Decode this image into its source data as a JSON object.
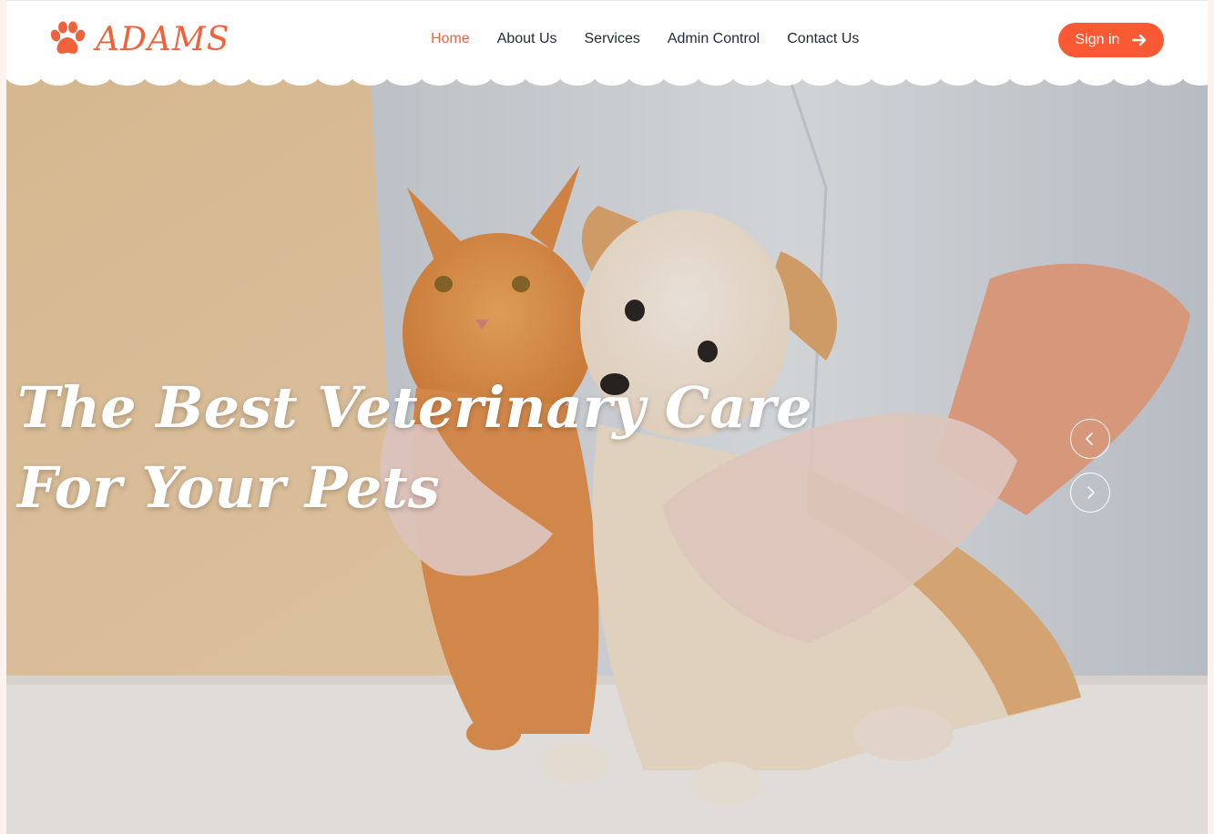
{
  "brand": {
    "name": "ADAMS",
    "icon": "paw-icon",
    "color": "#f0623c"
  },
  "nav": {
    "items": [
      {
        "label": "Home",
        "active": true
      },
      {
        "label": "About Us",
        "active": false
      },
      {
        "label": "Services",
        "active": false
      },
      {
        "label": "Admin Control",
        "active": false
      },
      {
        "label": "Contact Us",
        "active": false
      }
    ],
    "active_color": "#f0623c",
    "text_color": "#1d2a3a"
  },
  "signin": {
    "label": "Sign in",
    "icon": "arrow-right-icon",
    "color": "#f95a34"
  },
  "hero": {
    "title": "The Best Veterinary Care For Your Pets",
    "image": "kitten-and-puppy-held-by-veterinarian",
    "controls": {
      "prev_icon": "chevron-left-icon",
      "next_icon": "chevron-right-icon"
    }
  }
}
